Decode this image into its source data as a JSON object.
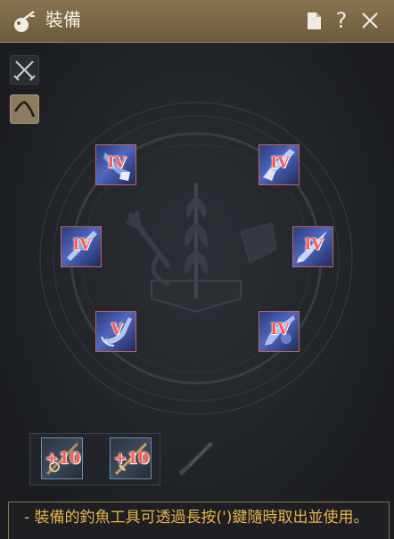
{
  "window": {
    "title": "裝備",
    "icon": "fishing-lure-icon",
    "buttons": {
      "doc": "document-icon",
      "help": "?",
      "close": "close-icon"
    }
  },
  "side_tabs": [
    {
      "icon": "crossed-swords-icon",
      "active": false
    },
    {
      "icon": "fishing-rod-icon",
      "active": true
    }
  ],
  "slots": [
    {
      "grade": "IV",
      "icon": "chum-bucket-icon"
    },
    {
      "grade": "IV",
      "icon": "fishing-knife-icon"
    },
    {
      "grade": "IV",
      "icon": "fishing-float-icon"
    },
    {
      "grade": "IV",
      "icon": "fishing-blade-icon"
    },
    {
      "grade": "V",
      "icon": "fishing-hook-icon"
    },
    {
      "grade": "IV",
      "icon": "fishing-reel-icon"
    }
  ],
  "bottom_slots": [
    {
      "label": "+10",
      "icon": "fishing-rod-icon"
    },
    {
      "label": "+10",
      "icon": "fishing-rod-icon"
    }
  ],
  "empty_slot_icon": "knife-silhouette-icon",
  "note": "- 裝備的釣魚工具可透過長按(')鍵隨時取出並使用。",
  "colors": {
    "header": "#7a6447",
    "grade": "#ff5a4e",
    "note_text": "#e9b24b",
    "slot_border": "#c0665c"
  }
}
